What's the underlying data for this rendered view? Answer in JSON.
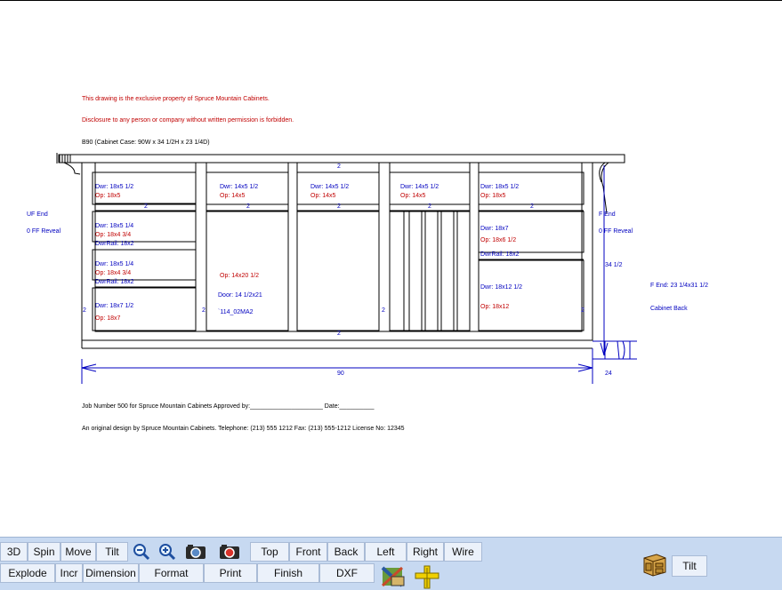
{
  "drawing": {
    "notice_line1": "This drawing is the exclusive property of Spruce Mountain Cabinets.",
    "notice_line2": "Disclosure to any person or company without written permission is forbidden.",
    "cabinet_title": "B90    (Cabinet Case: 90W x 34 1/2H x 23 1/4D)",
    "left_end_label": "UF End",
    "left_reveal": "0 FF Reveal",
    "right_end_label": "F End",
    "right_reveal": "0 FF Reveal",
    "height_dim": "34 1/2",
    "right_side_note": "F End: 23 1/4x31 1/2",
    "right_side_note2": "Cabinet Back",
    "width_dim": "90",
    "depth_dim": "24",
    "dim_top": "2",
    "dim_bottom": "2",
    "rail_marks": [
      "2",
      "2",
      "2",
      "2",
      "2",
      "2",
      "2",
      "2",
      "2"
    ],
    "col1": {
      "d1": "Dwr: 18x5 1/2",
      "o1": "Op: 18x5",
      "d2": "Dwr: 18x5 1/4",
      "o2": "Op: 18x4 3/4",
      "r2": "DwrRail: 18x2",
      "d3": "Dwr: 18x5 1/4",
      "o3": "Op: 18x4 3/4",
      "r3": "DwrRail: 18x2",
      "d4": "Dwr: 18x7 1/2",
      "o4": "Op: 18x7"
    },
    "col2": {
      "d1": "Dwr: 14x5 1/2",
      "o1": "Op: 14x5",
      "o2": "Op: 14x20 1/2",
      "door": "Door: 14 1/2x21",
      "door_code": "`114_02MA2"
    },
    "col3": {
      "d1": "Dwr: 14x5 1/2",
      "o1": "Op: 14x5"
    },
    "col4": {
      "d1": "Dwr: 14x5 1/2",
      "o1": "Op: 14x5"
    },
    "col5": {
      "d1": "Dwr: 18x5 1/2",
      "o1": "Op: 18x5",
      "d2": "Dwr: 18x7",
      "o2": "Op: 18x6 1/2",
      "r2": "DwrRail: 18x2",
      "d3": "Dwr: 18x12 1/2",
      "o3": "Op: 18x12"
    },
    "job_line": "Job Number 500 for Spruce Mountain Cabinets       Approved by:_____________________  Date:__________",
    "design_line": "An original design by Spruce Mountain Cabinets.  Telephone:  (213) 555 1212   Fax:  (213) 555-1212   License No:  12345"
  },
  "toolbar": {
    "row1": [
      "3D",
      "Spin",
      "Move",
      "Tilt",
      "Top",
      "Front",
      "Back",
      "Left",
      "Right",
      "Wire"
    ],
    "row2": [
      "Explode",
      "Incr",
      "Dimension",
      "Format",
      "Print",
      "Finish",
      "DXF"
    ],
    "tilt_label": "Tilt"
  },
  "colors": {
    "toolbar_bg": "#c7d9f1",
    "dim_blue": "#0000c0",
    "note_red": "#c00000"
  }
}
